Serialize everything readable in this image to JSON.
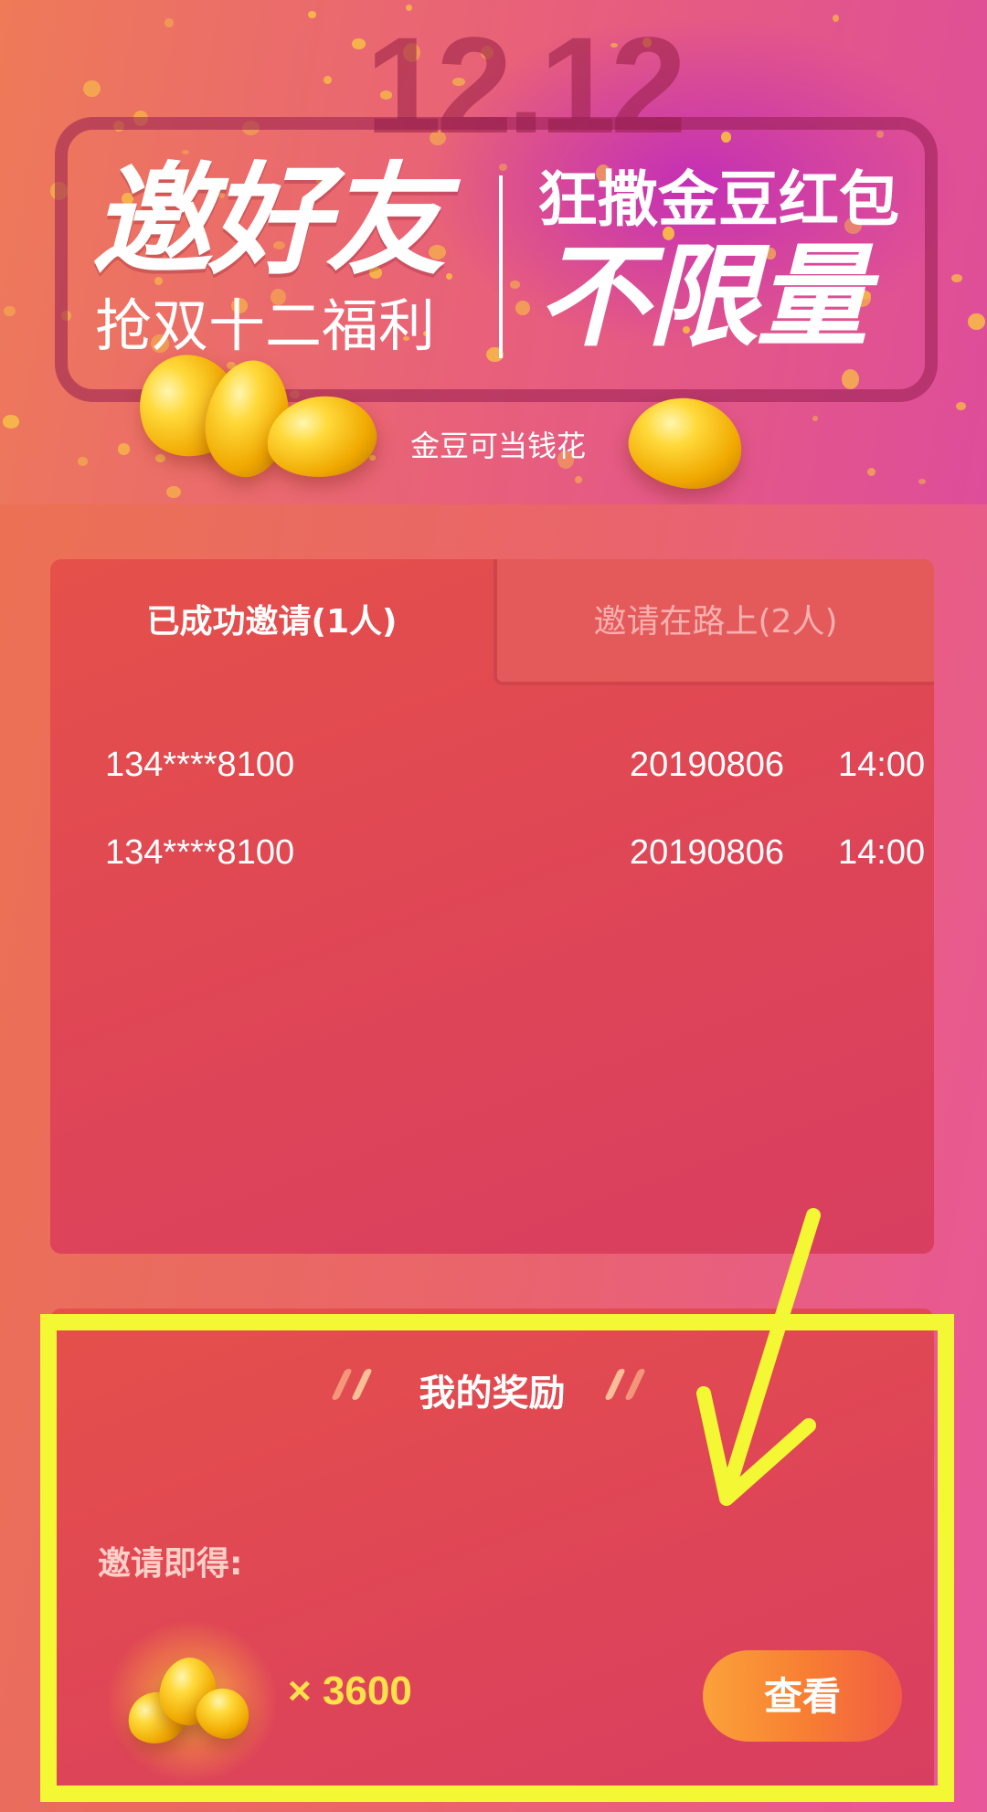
{
  "banner": {
    "date": "12.12",
    "title_main": "邀好友",
    "title_sub": "抢双十二福利",
    "title_right_top": "狂撒金豆红包",
    "title_right_big": "不限量",
    "tagline": "金豆可当钱花"
  },
  "invite": {
    "tabs": [
      {
        "label": "已成功邀请(1人)",
        "active": true
      },
      {
        "label": "邀请在路上(2人)",
        "active": false
      }
    ],
    "rows": [
      {
        "phone": "134****8100",
        "date": "20190806",
        "time": "14:00"
      },
      {
        "phone": "134****8100",
        "date": "20190806",
        "time": "14:00"
      }
    ]
  },
  "reward": {
    "title": "我的奖励",
    "label": "邀请即得:",
    "amount": "× 3600",
    "button_label": "查看"
  },
  "colors": {
    "highlight": "#f4f734",
    "card": "#de4458",
    "button_start": "#fba23a",
    "button_end": "#f15c45",
    "amount": "#ffe14a"
  },
  "icons": {
    "reward_icon": "gold-beans-icon",
    "annotation": "arrow-icon"
  }
}
